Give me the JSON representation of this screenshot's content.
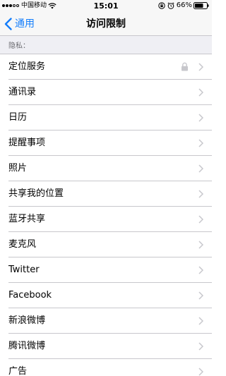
{
  "status_bar": {
    "carrier": "中国移动",
    "time": "15:01",
    "battery": "66%"
  },
  "nav": {
    "back_label": "通用",
    "title": "访问限制"
  },
  "section": {
    "header": "隐私："
  },
  "items": [
    {
      "label": "定位服务",
      "locked": true
    },
    {
      "label": "通讯录"
    },
    {
      "label": "日历"
    },
    {
      "label": "提醒事项"
    },
    {
      "label": "照片"
    },
    {
      "label": "共享我的位置"
    },
    {
      "label": "蓝牙共享"
    },
    {
      "label": "麦克风"
    },
    {
      "label": "Twitter"
    },
    {
      "label": "Facebook"
    },
    {
      "label": "新浪微博"
    },
    {
      "label": "腾讯微博"
    },
    {
      "label": "广告"
    }
  ],
  "colors": {
    "accent": "#147efb",
    "separator": "#c8c7cc",
    "section_bg": "#efeff4",
    "chevron": "#c7c7cc"
  }
}
